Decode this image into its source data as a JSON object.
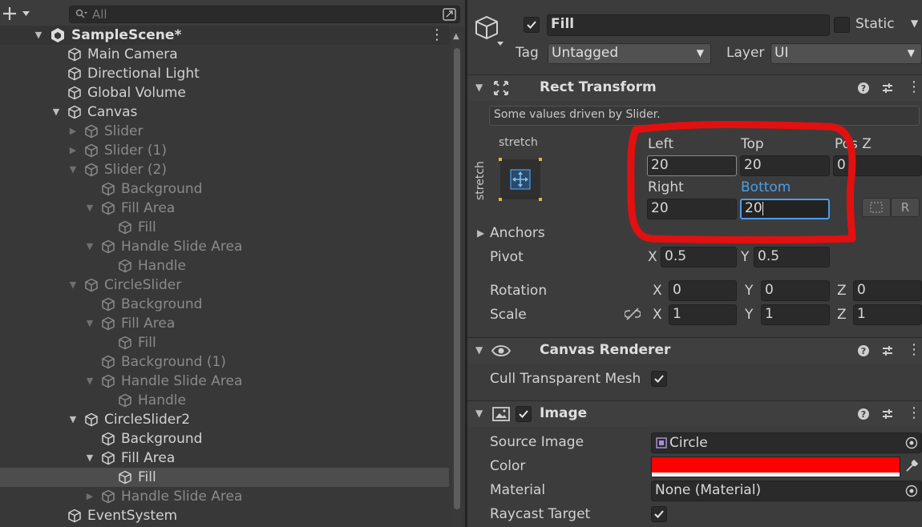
{
  "hierarchy": {
    "search_placeholder": "All",
    "scene_name": "SampleScene*",
    "items": [
      {
        "label": "Main Camera",
        "depth": 1,
        "arrow": "",
        "dim": false
      },
      {
        "label": "Directional Light",
        "depth": 1,
        "arrow": "",
        "dim": false
      },
      {
        "label": "Global Volume",
        "depth": 1,
        "arrow": "",
        "dim": false
      },
      {
        "label": "Canvas",
        "depth": 1,
        "arrow": "▼",
        "dim": false
      },
      {
        "label": "Slider",
        "depth": 2,
        "arrow": "▶",
        "dim": true
      },
      {
        "label": "Slider (1)",
        "depth": 2,
        "arrow": "▶",
        "dim": true
      },
      {
        "label": "Slider (2)",
        "depth": 2,
        "arrow": "▼",
        "dim": true
      },
      {
        "label": "Background",
        "depth": 3,
        "arrow": "",
        "dim": true
      },
      {
        "label": "Fill Area",
        "depth": 3,
        "arrow": "▼",
        "dim": true
      },
      {
        "label": "Fill",
        "depth": 4,
        "arrow": "",
        "dim": true
      },
      {
        "label": "Handle Slide Area",
        "depth": 3,
        "arrow": "▼",
        "dim": true
      },
      {
        "label": "Handle",
        "depth": 4,
        "arrow": "",
        "dim": true
      },
      {
        "label": "CircleSlider",
        "depth": 2,
        "arrow": "▼",
        "dim": true
      },
      {
        "label": "Background",
        "depth": 3,
        "arrow": "",
        "dim": true
      },
      {
        "label": "Fill Area",
        "depth": 3,
        "arrow": "▼",
        "dim": true
      },
      {
        "label": "Fill",
        "depth": 4,
        "arrow": "",
        "dim": true
      },
      {
        "label": "Background (1)",
        "depth": 3,
        "arrow": "",
        "dim": true
      },
      {
        "label": "Handle Slide Area",
        "depth": 3,
        "arrow": "▼",
        "dim": true
      },
      {
        "label": "Handle",
        "depth": 4,
        "arrow": "",
        "dim": true
      },
      {
        "label": "CircleSlider2",
        "depth": 2,
        "arrow": "▼",
        "dim": false
      },
      {
        "label": "Background",
        "depth": 3,
        "arrow": "",
        "dim": false
      },
      {
        "label": "Fill Area",
        "depth": 3,
        "arrow": "▼",
        "dim": false
      },
      {
        "label": "Fill",
        "depth": 4,
        "arrow": "",
        "dim": false,
        "selected": true
      },
      {
        "label": "Handle Slide Area",
        "depth": 3,
        "arrow": "▶",
        "dim": true
      },
      {
        "label": "EventSystem",
        "depth": 1,
        "arrow": "",
        "dim": false
      }
    ]
  },
  "inspector": {
    "object_name": "Fill",
    "static_label": "Static",
    "tag_label": "Tag",
    "tag_value": "Untagged",
    "layer_label": "Layer",
    "layer_value": "UI",
    "rect_transform": {
      "title": "Rect Transform",
      "info": "Some values driven by Slider.",
      "anchor_h": "stretch",
      "anchor_v": "stretch",
      "left_label": "Left",
      "left": "20",
      "top_label": "Top",
      "top": "20",
      "posz_label": "Pos Z",
      "posz": "0",
      "right_label": "Right",
      "right": "20",
      "bottom_label": "Bottom",
      "bottom": "20",
      "r_button": "R",
      "anchors_label": "Anchors",
      "pivot_label": "Pivot",
      "pivot_x": "0.5",
      "pivot_y": "0.5",
      "rotation_label": "Rotation",
      "rot_x": "0",
      "rot_y": "0",
      "rot_z": "0",
      "scale_label": "Scale",
      "scale_x": "1",
      "scale_y": "1",
      "scale_z": "1",
      "x": "X",
      "y": "Y",
      "z": "Z"
    },
    "canvas_renderer": {
      "title": "Canvas Renderer",
      "cull_label": "Cull Transparent Mesh"
    },
    "image": {
      "title": "Image",
      "source_label": "Source Image",
      "source_value": "Circle",
      "color_label": "Color",
      "color_value": "#ff0000",
      "material_label": "Material",
      "material_value": "None (Material)",
      "raycast_label": "Raycast Target"
    },
    "annotation_color": "#e21010",
    "accent_blue": "#4c9ee8"
  }
}
